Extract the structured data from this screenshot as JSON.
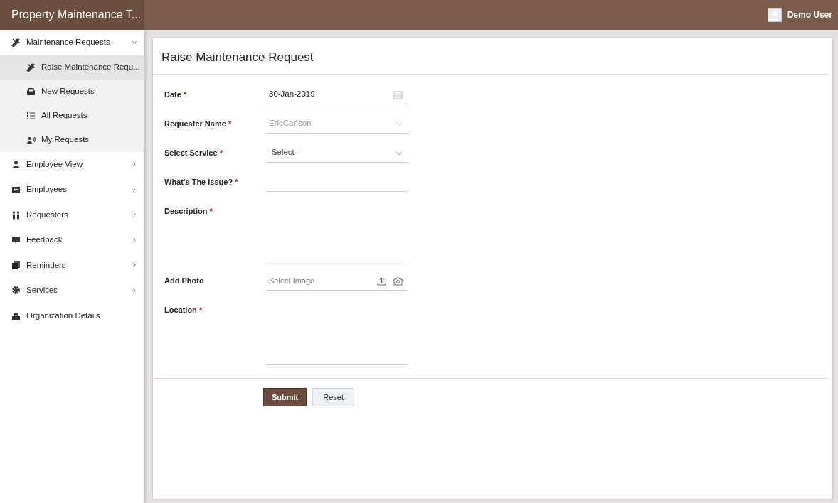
{
  "header": {
    "title": "Property Maintenance T...",
    "user": "Demo User"
  },
  "sidebar": {
    "items": [
      {
        "label": "Maintenance Requests",
        "expanded": true,
        "children": [
          {
            "label": "Raise Maintenance Requ...",
            "selected": true
          },
          {
            "label": "New Requests",
            "selected": false
          },
          {
            "label": "All Requests",
            "selected": false
          },
          {
            "label": "My Requests",
            "selected": false
          }
        ]
      },
      {
        "label": "Employee View",
        "expanded": false
      },
      {
        "label": "Employees",
        "expanded": false
      },
      {
        "label": "Requesters",
        "expanded": false
      },
      {
        "label": "Feedback",
        "expanded": false
      },
      {
        "label": "Reminders",
        "expanded": false
      },
      {
        "label": "Services",
        "expanded": false
      },
      {
        "label": "Organization Details"
      }
    ]
  },
  "form": {
    "title": "Raise Maintenance Request",
    "fields": [
      {
        "kind": "date",
        "label": "Date",
        "required_mark": "*",
        "value": "30-Jan-2019"
      },
      {
        "kind": "select",
        "label": "Requester Name",
        "required_mark": "*",
        "value": "EricCarlson",
        "disabled": true
      },
      {
        "kind": "select",
        "label": "Select Service",
        "required_mark": "*",
        "value": "-Select-",
        "disabled": false
      },
      {
        "kind": "text",
        "label": "What's The Issue?",
        "required_mark": "*"
      },
      {
        "kind": "textarea",
        "label": "Description",
        "required_mark": "*"
      },
      {
        "kind": "file",
        "label": "Add Photo",
        "placeholder": "Select Image"
      },
      {
        "kind": "textarea",
        "label": "Location",
        "required_mark": "*"
      }
    ],
    "buttons": [
      {
        "label": "Submit",
        "kind": "primary"
      },
      {
        "label": "Reset",
        "kind": "secondary"
      }
    ]
  }
}
